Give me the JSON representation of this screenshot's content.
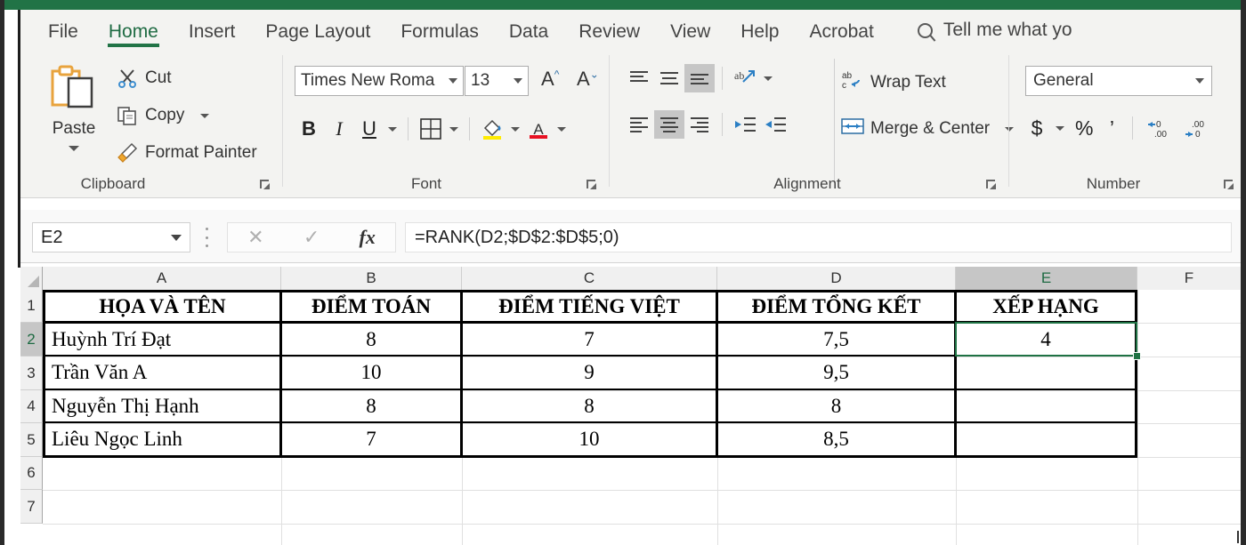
{
  "ribbon": {
    "tabs": [
      {
        "label": "File",
        "active": false
      },
      {
        "label": "Home",
        "active": true
      },
      {
        "label": "Insert",
        "active": false
      },
      {
        "label": "Page Layout",
        "active": false
      },
      {
        "label": "Formulas",
        "active": false
      },
      {
        "label": "Data",
        "active": false
      },
      {
        "label": "Review",
        "active": false
      },
      {
        "label": "View",
        "active": false
      },
      {
        "label": "Help",
        "active": false
      },
      {
        "label": "Acrobat",
        "active": false
      }
    ],
    "tell_me": "Tell me what yo",
    "groups": {
      "clipboard": {
        "label": "Clipboard",
        "paste": "Paste",
        "cut": "Cut",
        "copy": "Copy",
        "format_painter": "Format Painter"
      },
      "font": {
        "label": "Font",
        "font_name": "Times New Roma",
        "font_size": "13",
        "bold": "B",
        "italic": "I",
        "underline": "U"
      },
      "alignment": {
        "label": "Alignment",
        "wrap_text": "Wrap Text",
        "merge_center": "Merge & Center"
      },
      "number": {
        "label": "Number",
        "format": "General",
        "currency": "$",
        "percent": "%",
        "comma": "’"
      }
    }
  },
  "formula_bar": {
    "name_box": "E2",
    "formula": "=RANK(D2;$D$2:$D$5;0)",
    "cancel": "✕",
    "enter": "✓",
    "insert_function": "fx"
  },
  "grid": {
    "columns": [
      "A",
      "B",
      "C",
      "D",
      "E",
      "F"
    ],
    "selected_column": "E",
    "rows": [
      "1",
      "2",
      "3",
      "4",
      "5",
      "6",
      "7"
    ],
    "selected_row": "2",
    "active_cell": "E2",
    "headers": {
      "A": "HỌA VÀ TÊN",
      "B": "ĐIỂM TOÁN",
      "C": "ĐIỂM TIẾNG VIỆT",
      "D": "ĐIỂM TỔNG KẾT",
      "E": "XẾP HẠNG"
    },
    "header_row": {
      "A": "HỌA VÀ TÊN",
      "B": "ĐIỂM TOÁN",
      "C": "ĐIỂM TIẾNG VIỆT",
      "D": "ĐIỂM TỔNG KẾT",
      "E": "XẾP HẠNG"
    },
    "data": [
      {
        "row": "1",
        "A": "HỌA VÀ TÊN",
        "B": "ĐIỂM TOÁN",
        "C": "ĐIỂM TIẾNG VIỆT",
        "D": "ĐIỂM TỔNG KẾT",
        "E": "XẾP HẠNG"
      },
      {
        "row": "2",
        "A": "Huỳnh Trí Đạt",
        "B": "8",
        "C": "7",
        "D": "7,5",
        "E": "4"
      },
      {
        "row": "3",
        "A": "Trần Văn A",
        "B": "10",
        "C": "9",
        "D": "9,5",
        "E": ""
      },
      {
        "row": "4",
        "A": "Nguyễn Thị Hạnh",
        "B": "8",
        "C": "8",
        "D": "8",
        "E": ""
      },
      {
        "row": "5",
        "A": "Liêu Ngọc Linh",
        "B": "7",
        "C": "10",
        "D": "8,5",
        "E": ""
      },
      {
        "row": "6",
        "A": "",
        "B": "",
        "C": "",
        "D": "",
        "E": ""
      },
      {
        "row": "7",
        "A": "",
        "B": "",
        "C": "",
        "D": "",
        "E": ""
      }
    ]
  },
  "colors": {
    "excel_green": "#217346",
    "selection_green": "#1f7244",
    "ribbon_bg": "#f3f3f1",
    "header_gray": "#f0f0f0",
    "selected_gray": "#c6c6c6"
  }
}
